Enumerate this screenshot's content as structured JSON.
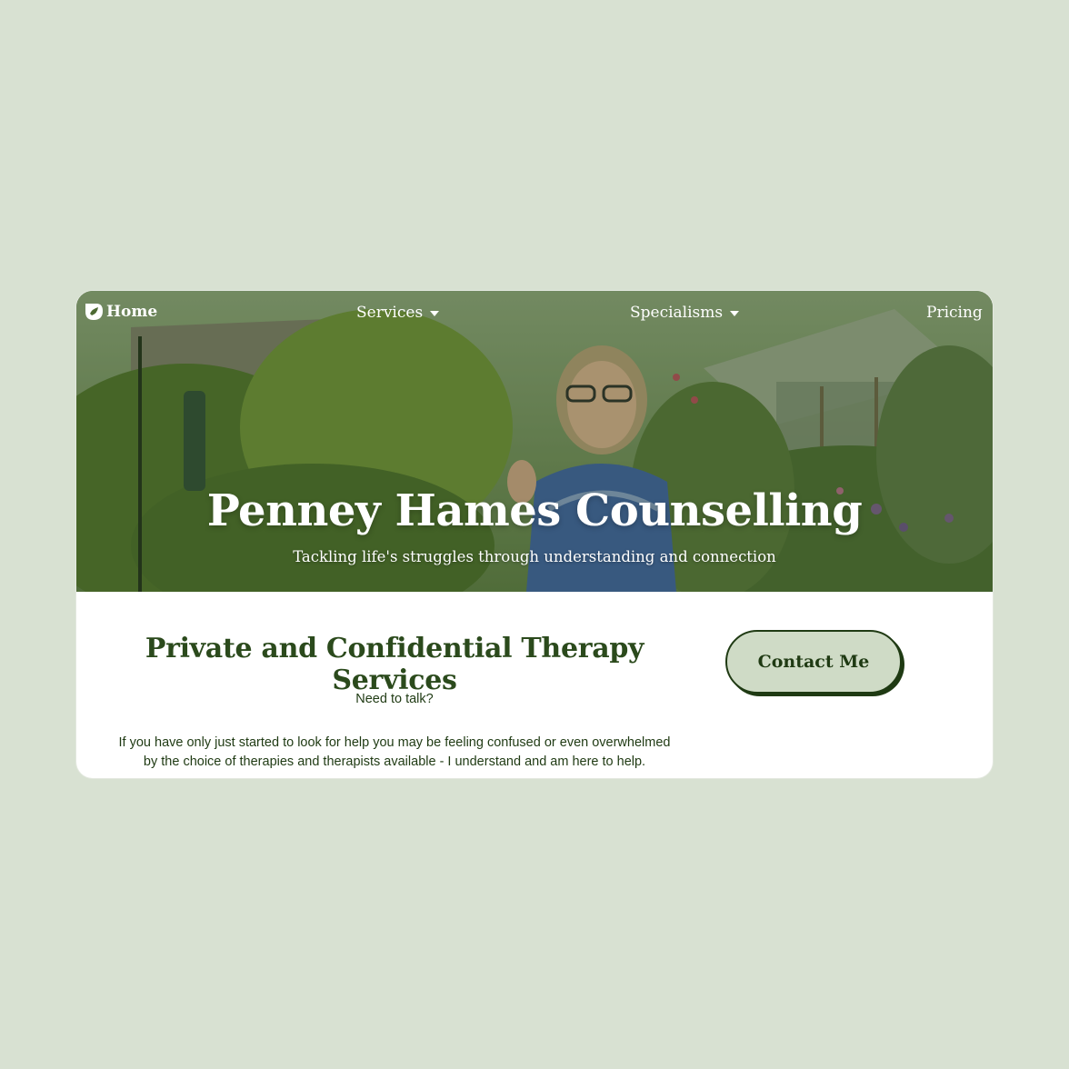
{
  "nav": {
    "home_label": "Home",
    "services_label": "Services",
    "specialisms_label": "Specialisms",
    "pricing_label": "Pricing"
  },
  "hero": {
    "title": "Penney Hames Counselling",
    "subtitle": "Tackling life's struggles through understanding and connection"
  },
  "main": {
    "heading": "Private and Confidential Therapy Services",
    "need_talk": "Need to talk?",
    "intro_line1": "If you have only just started to look for help you may be feeling confused or even overwhelmed",
    "intro_line2": "by the choice of therapies and therapists available - I understand and am here to help."
  },
  "cta": {
    "contact_label": "Contact Me"
  },
  "colors": {
    "page_background": "#d8e1d2",
    "brand_dark_green": "#1f3a13",
    "heading_green": "#2b4a1c",
    "button_fill": "#cfdbc6"
  },
  "icons": {
    "logo": "leaf-logo-icon",
    "dropdown": "caret-down-icon"
  }
}
